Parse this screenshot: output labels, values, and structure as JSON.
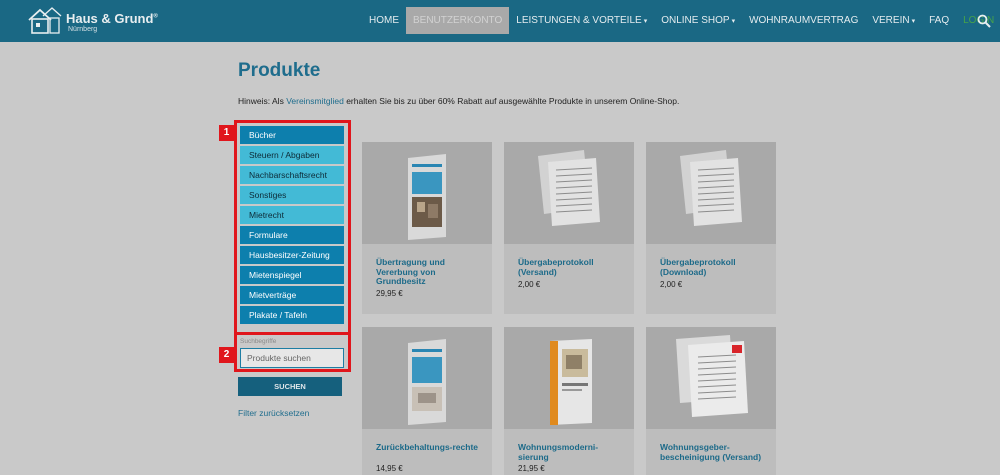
{
  "header": {
    "logo_title": "Haus & Grund",
    "logo_sub": "Nürnberg",
    "nav": [
      {
        "label": "HOME"
      },
      {
        "label": "BENUTZERKONTO"
      },
      {
        "label": "LEISTUNGEN & VORTEILE"
      },
      {
        "label": "ONLINE SHOP"
      },
      {
        "label": "WOHNRAUMVERTRAG"
      },
      {
        "label": "VEREIN"
      },
      {
        "label": "FAQ"
      },
      {
        "label": "LOGIN"
      }
    ]
  },
  "main": {
    "title": "Produkte",
    "notice_prefix": "Hinweis: Als ",
    "notice_link": "Vereinsmitglied",
    "notice_suffix": " erhalten Sie bis zu über 60% Rabatt auf ausgewählte Produkte in unserem Online-Shop."
  },
  "filter": {
    "categories": [
      {
        "label": "Bücher"
      },
      {
        "label": "Steuern / Abgaben"
      },
      {
        "label": "Nachbarschaftsrecht"
      },
      {
        "label": "Sonstiges"
      },
      {
        "label": "Mietrecht"
      },
      {
        "label": "Formulare"
      },
      {
        "label": "Hausbesitzer-Zeitung"
      },
      {
        "label": "Mietenspiegel"
      },
      {
        "label": "Mietverträge"
      },
      {
        "label": "Plakate / Tafeln"
      }
    ],
    "search_label": "Suchbegriffe",
    "search_placeholder": "Produkte suchen",
    "search_button": "SUCHEN",
    "reset_link": "Filter zurücksetzen",
    "badges": [
      "1",
      "2"
    ]
  },
  "products": [
    {
      "name": "Übertragung und Vererbung von Grundbesitz",
      "price": "29,95 €"
    },
    {
      "name": "Übergabeprotokoll (Versand)",
      "price": "2,00 €"
    },
    {
      "name": "Übergabeprotokoll (Download)",
      "price": "2,00 €"
    },
    {
      "name": "Zurückbehaltungs-rechte",
      "price": "14,95 €"
    },
    {
      "name": "Wohnungsmoderni-sierung",
      "price": "21,95 €"
    },
    {
      "name": "Wohnungsgeber-bescheinigung (Versand)",
      "price": ""
    }
  ],
  "colors": {
    "header": "#1a6884",
    "accent": "#1f6d8d",
    "category_dark": "#0d7fad",
    "category_light": "#43bad6",
    "highlight": "#e0161c",
    "login": "#46a24a"
  }
}
